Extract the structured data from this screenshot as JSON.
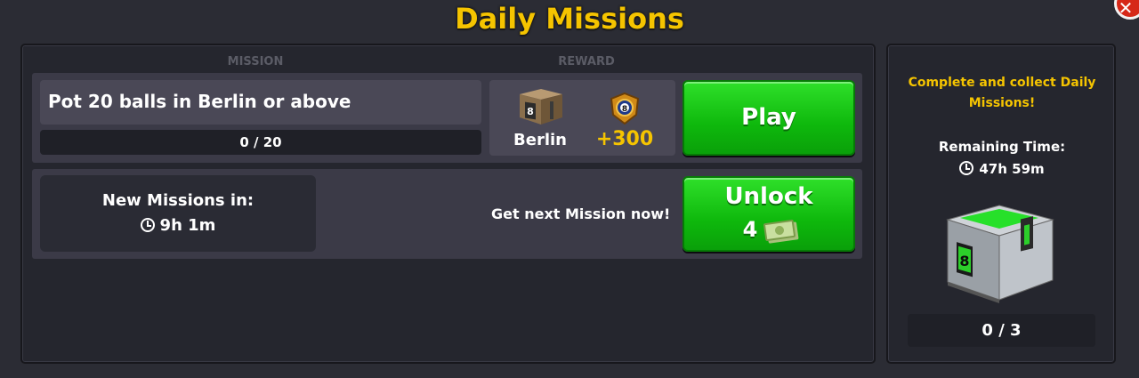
{
  "title": "Daily Missions",
  "columns": {
    "mission": "MISSION",
    "reward": "REWARD"
  },
  "mission": {
    "text": "Pot 20 balls in Berlin or above",
    "progress": "0 / 20",
    "reward_location": "Berlin",
    "reward_points": "+300",
    "play_label": "Play"
  },
  "next": {
    "new_missions_label": "New Missions in:",
    "new_missions_time": "9h 1m",
    "get_next_label": "Get next Mission now!",
    "unlock_label": "Unlock",
    "unlock_cost": "4"
  },
  "side": {
    "heading": "Complete and collect Daily Missions!",
    "remaining_label": "Remaining Time:",
    "remaining_time": "47h 59m",
    "count": "0 / 3"
  },
  "colors": {
    "accent": "#f5c400",
    "button": "#14c412",
    "close": "#d62818"
  },
  "icons": [
    "close-icon",
    "clock-icon",
    "berlin-box-icon",
    "badge-8-icon",
    "cash-icon",
    "reward-box-icon"
  ]
}
